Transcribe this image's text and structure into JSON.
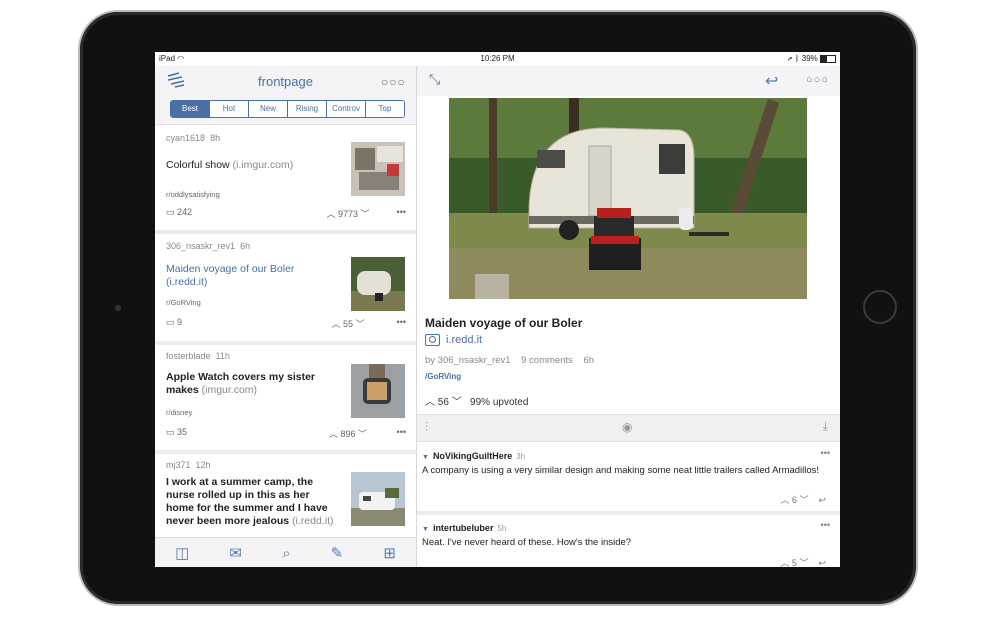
{
  "status_bar": {
    "device": "iPad",
    "time": "10:26 PM",
    "battery": "39%"
  },
  "left_pane": {
    "title": "frontpage",
    "tabs": [
      "Best",
      "Hot",
      "New",
      "Rising",
      "Controv",
      "Top"
    ],
    "active_tab": "Best",
    "posts": [
      {
        "author": "cyan1618",
        "age": "8h",
        "title": "Colorful show",
        "domain": "(i.imgur.com)",
        "subreddit": "r/oddlysatisfying",
        "comments": "242",
        "score": "9773",
        "visited": false
      },
      {
        "author": "306_nsaskr_rev1",
        "age": "6h",
        "title": "Maiden voyage of our Boler",
        "domain": "(i.redd.it)",
        "subreddit": "r/GoRVing",
        "comments": "9",
        "score": "55",
        "visited": true
      },
      {
        "author": "fosterblade",
        "age": "11h",
        "title": "Apple Watch covers my sister makes",
        "domain": "(imgur.com)",
        "subreddit": "r/disney",
        "comments": "35",
        "score": "896",
        "visited": false
      },
      {
        "author": "mj371",
        "age": "12h",
        "title": "I work at a summer camp, the nurse rolled up in this as her home for the summer and I have never been more jealous",
        "domain": "(i.redd.it)",
        "subreddit": "",
        "comments": "",
        "score": "",
        "visited": false
      }
    ]
  },
  "detail": {
    "title": "Maiden voyage of our Boler",
    "link": "i.redd.it",
    "author": "by 306_nsaskr_rev1",
    "comments": "9 comments",
    "age": "6h",
    "subreddit": "/GoRVing",
    "score": "56",
    "upvoted": "99% upvoted"
  },
  "comments": [
    {
      "author": "NoVikingGuiltHere",
      "age": "3h",
      "text": "A company is using a very similar design and making some neat little trailers called Armadillos!",
      "score": "6"
    },
    {
      "author": "intertubeluber",
      "age": "5h",
      "text": "Neat.  I've never heard of these.  How's the inside?",
      "score": "5"
    }
  ],
  "colors": {
    "accent": "#4a6fa5",
    "toolbar_bg": "#f4f4f6"
  }
}
